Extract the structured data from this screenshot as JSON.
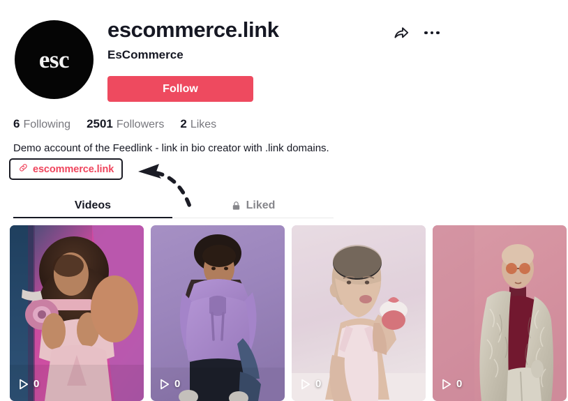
{
  "profile": {
    "avatar_text": "esc",
    "avatar_icon": "account-avatar",
    "username": "escommerce.link",
    "display_name": "EsCommerce",
    "follow_label": "Follow",
    "share_icon": "share-arrow-icon",
    "more_icon": "more-options-icon"
  },
  "stats": [
    {
      "value": "6",
      "label": "Following",
      "name": "following"
    },
    {
      "value": "2501",
      "label": "Followers",
      "name": "followers"
    },
    {
      "value": "2",
      "label": "Likes",
      "name": "likes"
    }
  ],
  "bio": {
    "text": "Demo account of the Feedlink - link in bio creator with .link domains.",
    "link_text": "escommerce.link",
    "link_icon": "chain-link-icon"
  },
  "annotation": {
    "name": "dashed-arrow-annotation",
    "points_to": "bio-link-chip"
  },
  "tabs": [
    {
      "label": "Videos",
      "active": true,
      "icon": null
    },
    {
      "label": "Liked",
      "active": false,
      "icon": "lock-icon"
    }
  ],
  "videos": [
    {
      "play_count": "0",
      "alt": "woman with curly hair holding pink camera"
    },
    {
      "play_count": "0",
      "alt": "man in purple hoodie crouching"
    },
    {
      "play_count": "0",
      "alt": "person with shaved head holding cupcake"
    },
    {
      "play_count": "0",
      "alt": "person in fur coat with sunglasses"
    }
  ],
  "colors": {
    "accent": "#ee4a5e",
    "text_primary": "#161823",
    "text_secondary": "#77777d",
    "divider": "#e9e9ea"
  }
}
